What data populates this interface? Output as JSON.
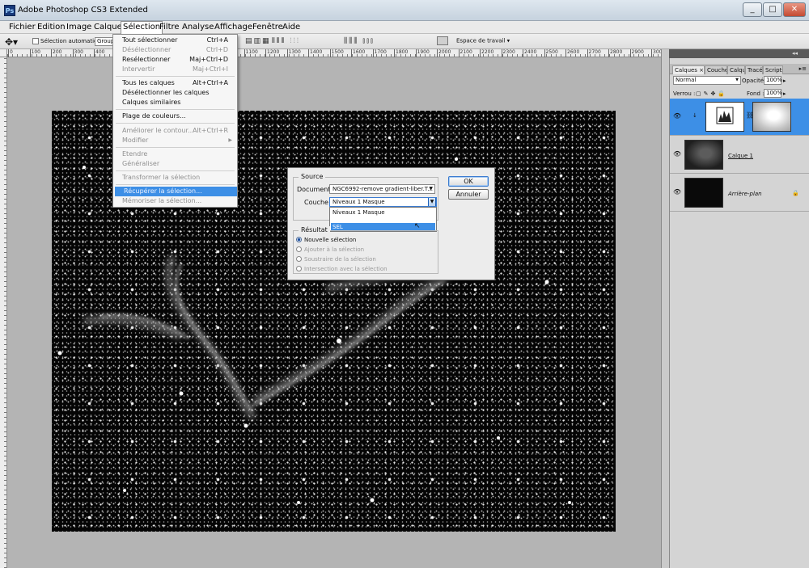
{
  "window": {
    "title": "Adobe Photoshop CS3 Extended",
    "app_icon": "Ps",
    "controls": [
      "_",
      "□",
      "✕"
    ]
  },
  "menubar": [
    "Fichier",
    "Edition",
    "Image",
    "Calque",
    "Sélection",
    "Filtre",
    "Analyse",
    "Affichage",
    "Fenêtre",
    "Aide"
  ],
  "options_bar": {
    "tool_icon": "move-tool-icon",
    "auto_select_label": "Sélection automatique :",
    "auto_select_value": "Groupe",
    "workspace_label": "Espace de travail ▾"
  },
  "ruler": {
    "ticks": [
      "0",
      "100",
      "200",
      "300",
      "400",
      "500",
      "600",
      "700",
      "800",
      "900",
      "1000",
      "1100",
      "1200",
      "1300",
      "1400",
      "1500",
      "1600",
      "1700",
      "1800",
      "1900",
      "2000",
      "2100",
      "2200",
      "2300",
      "2400",
      "2500",
      "2600",
      "2700",
      "2800",
      "2900",
      "3000"
    ]
  },
  "selection_menu": {
    "items": [
      {
        "label": "Tout sélectionner",
        "shortcut": "Ctrl+A",
        "enabled": true
      },
      {
        "label": "Désélectionner",
        "shortcut": "Ctrl+D",
        "enabled": false
      },
      {
        "label": "Resélectionner",
        "shortcut": "Maj+Ctrl+D",
        "enabled": true
      },
      {
        "label": "Intervertir",
        "shortcut": "Maj+Ctrl+I",
        "enabled": false
      },
      {
        "label": "Tous les calques",
        "shortcut": "Alt+Ctrl+A",
        "enabled": true
      },
      {
        "label": "Désélectionner les calques",
        "shortcut": "",
        "enabled": true
      },
      {
        "label": "Calques similaires",
        "shortcut": "",
        "enabled": true
      },
      {
        "label": "Plage de couleurs...",
        "shortcut": "",
        "enabled": true
      },
      {
        "label": "Améliorer le contour...",
        "shortcut": "Alt+Ctrl+R",
        "enabled": false
      },
      {
        "label": "Modifier",
        "shortcut": "",
        "enabled": false,
        "submenu": true
      },
      {
        "label": "Etendre",
        "shortcut": "",
        "enabled": false
      },
      {
        "label": "Généraliser",
        "shortcut": "",
        "enabled": false
      },
      {
        "label": "Transformer la sélection",
        "shortcut": "",
        "enabled": false
      },
      {
        "label": "Récupérer la sélection...",
        "shortcut": "",
        "enabled": true,
        "highlighted": true
      },
      {
        "label": "Mémoriser la sélection...",
        "shortcut": "",
        "enabled": false
      }
    ]
  },
  "dialog": {
    "source_legend": "Source",
    "document_label": "Document :",
    "document_value": "NGC6992-remove gradient-liber.T...",
    "couche_label": "Couche :",
    "couche_value": "Niveaux 1 Masque",
    "couche_options": [
      "Niveaux 1 Masque",
      "SEL"
    ],
    "couche_highlighted": "SEL",
    "result_legend": "Résultat",
    "radios": [
      {
        "label": "Nouvelle sélection",
        "checked": true,
        "enabled": true
      },
      {
        "label": "Ajouter à la sélection",
        "checked": false,
        "enabled": false
      },
      {
        "label": "Soustraire de la sélection",
        "checked": false,
        "enabled": false
      },
      {
        "label": "Intersection avec la sélection",
        "checked": false,
        "enabled": false
      }
    ],
    "ok": "OK",
    "cancel": "Annuler"
  },
  "layers_panel": {
    "tabs": [
      "Calques ×",
      "Couches",
      "Calques",
      "Tracés",
      "Scripts"
    ],
    "blend_mode": "Normal",
    "opacity_label": "Opacité :",
    "opacity_value": "100%",
    "lock_label": "Verrou :",
    "fill_label": "Fond :",
    "fill_value": "100%",
    "layers": [
      {
        "name": "",
        "selected": true,
        "type": "adjustment"
      },
      {
        "name": "Calque 1",
        "selected": false,
        "type": "pixel"
      },
      {
        "name": "Arrière-plan",
        "selected": false,
        "type": "background",
        "locked": true
      }
    ]
  },
  "colors": {
    "highlight": "#3d8fe6",
    "menu_bg": "#f6f6f6",
    "panel_bg": "#d4d4d4"
  }
}
